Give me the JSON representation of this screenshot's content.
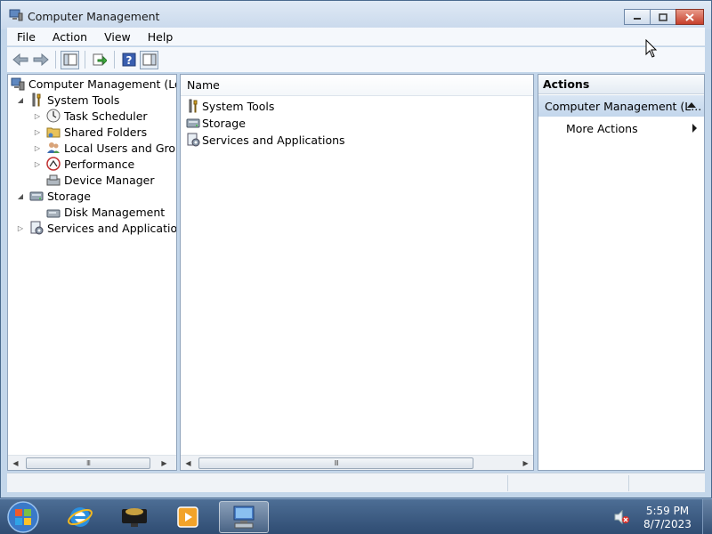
{
  "window": {
    "title": "Computer Management"
  },
  "menu": {
    "items": [
      "File",
      "Action",
      "View",
      "Help"
    ]
  },
  "toolbar": {
    "buttons": [
      "back-arrow-icon",
      "forward-arrow-icon",
      "show-hide-console-tree-icon",
      "export-list-icon",
      "help-icon",
      "show-hide-action-pane-icon"
    ]
  },
  "tree": {
    "root": "Computer Management (Local",
    "items": [
      {
        "label": "System Tools",
        "icon": "tools-icon",
        "expanded": true
      },
      {
        "label": "Task Scheduler",
        "icon": "clock-icon"
      },
      {
        "label": "Shared Folders",
        "icon": "shared-folder-icon"
      },
      {
        "label": "Local Users and Groups",
        "icon": "users-icon"
      },
      {
        "label": "Performance",
        "icon": "performance-icon"
      },
      {
        "label": "Device Manager",
        "icon": "device-manager-icon"
      },
      {
        "label": "Storage",
        "icon": "storage-icon",
        "expanded": true
      },
      {
        "label": "Disk Management",
        "icon": "disk-icon"
      },
      {
        "label": "Services and Applications",
        "icon": "services-icon"
      }
    ]
  },
  "list": {
    "column_name": "Name",
    "rows": [
      "System Tools",
      "Storage",
      "Services and Applications"
    ]
  },
  "actions": {
    "header": "Actions",
    "section": "Computer Management (L...",
    "more": "More Actions"
  },
  "taskbar": {
    "time": "5:59 PM",
    "date": "8/7/2023"
  }
}
